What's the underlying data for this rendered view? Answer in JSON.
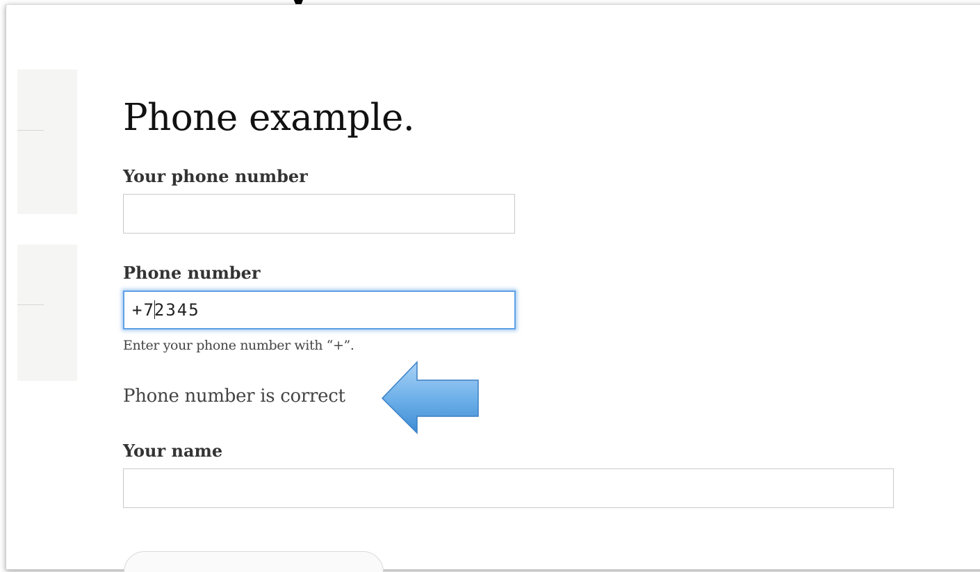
{
  "page": {
    "title": "Phone example."
  },
  "form": {
    "phone_field": {
      "label": "Your phone number",
      "value": ""
    },
    "phone_number_field": {
      "label": "Phone number",
      "value_before_caret": "+7",
      "value_after_caret": "2345",
      "hint": "Enter your phone number with “+”.",
      "validation_message": "Phone number is correct"
    },
    "name_field": {
      "label": "Your name",
      "value": ""
    }
  },
  "annotation": {
    "arrow_color": "#6aaee8",
    "arrow_direction": "left",
    "arrow_icon": "left-arrow-icon"
  },
  "colors": {
    "focus_ring": "#5ea0e6",
    "field_border": "#c9c9c9",
    "side_panel": "#f5f5f3"
  }
}
